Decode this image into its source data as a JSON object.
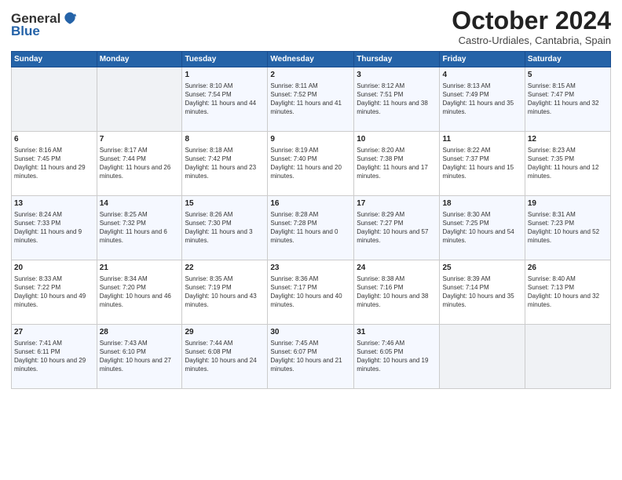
{
  "header": {
    "logo": {
      "line1": "General",
      "line2": "Blue"
    },
    "title": "October 2024",
    "location": "Castro-Urdiales, Cantabria, Spain"
  },
  "calendar": {
    "weekdays": [
      "Sunday",
      "Monday",
      "Tuesday",
      "Wednesday",
      "Thursday",
      "Friday",
      "Saturday"
    ],
    "weeks": [
      [
        {
          "day": "",
          "info": ""
        },
        {
          "day": "",
          "info": ""
        },
        {
          "day": "1",
          "info": "Sunrise: 8:10 AM\nSunset: 7:54 PM\nDaylight: 11 hours and 44 minutes."
        },
        {
          "day": "2",
          "info": "Sunrise: 8:11 AM\nSunset: 7:52 PM\nDaylight: 11 hours and 41 minutes."
        },
        {
          "day": "3",
          "info": "Sunrise: 8:12 AM\nSunset: 7:51 PM\nDaylight: 11 hours and 38 minutes."
        },
        {
          "day": "4",
          "info": "Sunrise: 8:13 AM\nSunset: 7:49 PM\nDaylight: 11 hours and 35 minutes."
        },
        {
          "day": "5",
          "info": "Sunrise: 8:15 AM\nSunset: 7:47 PM\nDaylight: 11 hours and 32 minutes."
        }
      ],
      [
        {
          "day": "6",
          "info": "Sunrise: 8:16 AM\nSunset: 7:45 PM\nDaylight: 11 hours and 29 minutes."
        },
        {
          "day": "7",
          "info": "Sunrise: 8:17 AM\nSunset: 7:44 PM\nDaylight: 11 hours and 26 minutes."
        },
        {
          "day": "8",
          "info": "Sunrise: 8:18 AM\nSunset: 7:42 PM\nDaylight: 11 hours and 23 minutes."
        },
        {
          "day": "9",
          "info": "Sunrise: 8:19 AM\nSunset: 7:40 PM\nDaylight: 11 hours and 20 minutes."
        },
        {
          "day": "10",
          "info": "Sunrise: 8:20 AM\nSunset: 7:38 PM\nDaylight: 11 hours and 17 minutes."
        },
        {
          "day": "11",
          "info": "Sunrise: 8:22 AM\nSunset: 7:37 PM\nDaylight: 11 hours and 15 minutes."
        },
        {
          "day": "12",
          "info": "Sunrise: 8:23 AM\nSunset: 7:35 PM\nDaylight: 11 hours and 12 minutes."
        }
      ],
      [
        {
          "day": "13",
          "info": "Sunrise: 8:24 AM\nSunset: 7:33 PM\nDaylight: 11 hours and 9 minutes."
        },
        {
          "day": "14",
          "info": "Sunrise: 8:25 AM\nSunset: 7:32 PM\nDaylight: 11 hours and 6 minutes."
        },
        {
          "day": "15",
          "info": "Sunrise: 8:26 AM\nSunset: 7:30 PM\nDaylight: 11 hours and 3 minutes."
        },
        {
          "day": "16",
          "info": "Sunrise: 8:28 AM\nSunset: 7:28 PM\nDaylight: 11 hours and 0 minutes."
        },
        {
          "day": "17",
          "info": "Sunrise: 8:29 AM\nSunset: 7:27 PM\nDaylight: 10 hours and 57 minutes."
        },
        {
          "day": "18",
          "info": "Sunrise: 8:30 AM\nSunset: 7:25 PM\nDaylight: 10 hours and 54 minutes."
        },
        {
          "day": "19",
          "info": "Sunrise: 8:31 AM\nSunset: 7:23 PM\nDaylight: 10 hours and 52 minutes."
        }
      ],
      [
        {
          "day": "20",
          "info": "Sunrise: 8:33 AM\nSunset: 7:22 PM\nDaylight: 10 hours and 49 minutes."
        },
        {
          "day": "21",
          "info": "Sunrise: 8:34 AM\nSunset: 7:20 PM\nDaylight: 10 hours and 46 minutes."
        },
        {
          "day": "22",
          "info": "Sunrise: 8:35 AM\nSunset: 7:19 PM\nDaylight: 10 hours and 43 minutes."
        },
        {
          "day": "23",
          "info": "Sunrise: 8:36 AM\nSunset: 7:17 PM\nDaylight: 10 hours and 40 minutes."
        },
        {
          "day": "24",
          "info": "Sunrise: 8:38 AM\nSunset: 7:16 PM\nDaylight: 10 hours and 38 minutes."
        },
        {
          "day": "25",
          "info": "Sunrise: 8:39 AM\nSunset: 7:14 PM\nDaylight: 10 hours and 35 minutes."
        },
        {
          "day": "26",
          "info": "Sunrise: 8:40 AM\nSunset: 7:13 PM\nDaylight: 10 hours and 32 minutes."
        }
      ],
      [
        {
          "day": "27",
          "info": "Sunrise: 7:41 AM\nSunset: 6:11 PM\nDaylight: 10 hours and 29 minutes."
        },
        {
          "day": "28",
          "info": "Sunrise: 7:43 AM\nSunset: 6:10 PM\nDaylight: 10 hours and 27 minutes."
        },
        {
          "day": "29",
          "info": "Sunrise: 7:44 AM\nSunset: 6:08 PM\nDaylight: 10 hours and 24 minutes."
        },
        {
          "day": "30",
          "info": "Sunrise: 7:45 AM\nSunset: 6:07 PM\nDaylight: 10 hours and 21 minutes."
        },
        {
          "day": "31",
          "info": "Sunrise: 7:46 AM\nSunset: 6:05 PM\nDaylight: 10 hours and 19 minutes."
        },
        {
          "day": "",
          "info": ""
        },
        {
          "day": "",
          "info": ""
        }
      ]
    ]
  }
}
